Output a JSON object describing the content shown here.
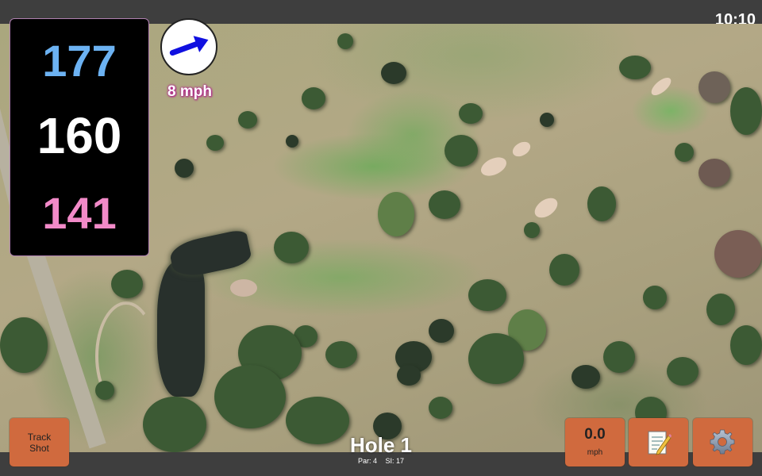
{
  "status_bar": {
    "time": "10:10"
  },
  "distances": {
    "back": "177",
    "center": "160",
    "front": "141"
  },
  "wind": {
    "speed_label": "8 mph",
    "direction_icon": "wind-arrow-icon",
    "direction": "east-northeast"
  },
  "hole": {
    "title": "Hole 1",
    "par_label": "Par: 4",
    "si_label": "SI: 17"
  },
  "buttons": {
    "track_shot_line1": "Track",
    "track_shot_line2": "Shot",
    "speed_value": "0.0",
    "speed_unit": "mph",
    "notes_icon": "memo-icon",
    "settings_icon": "gear-icon"
  },
  "colors": {
    "back_distance": "#6cb2f2",
    "center_distance": "#ffffff",
    "front_distance": "#f28ac8",
    "button_bg": "#d06a3e",
    "wind_text_glow": "#b0208a"
  }
}
